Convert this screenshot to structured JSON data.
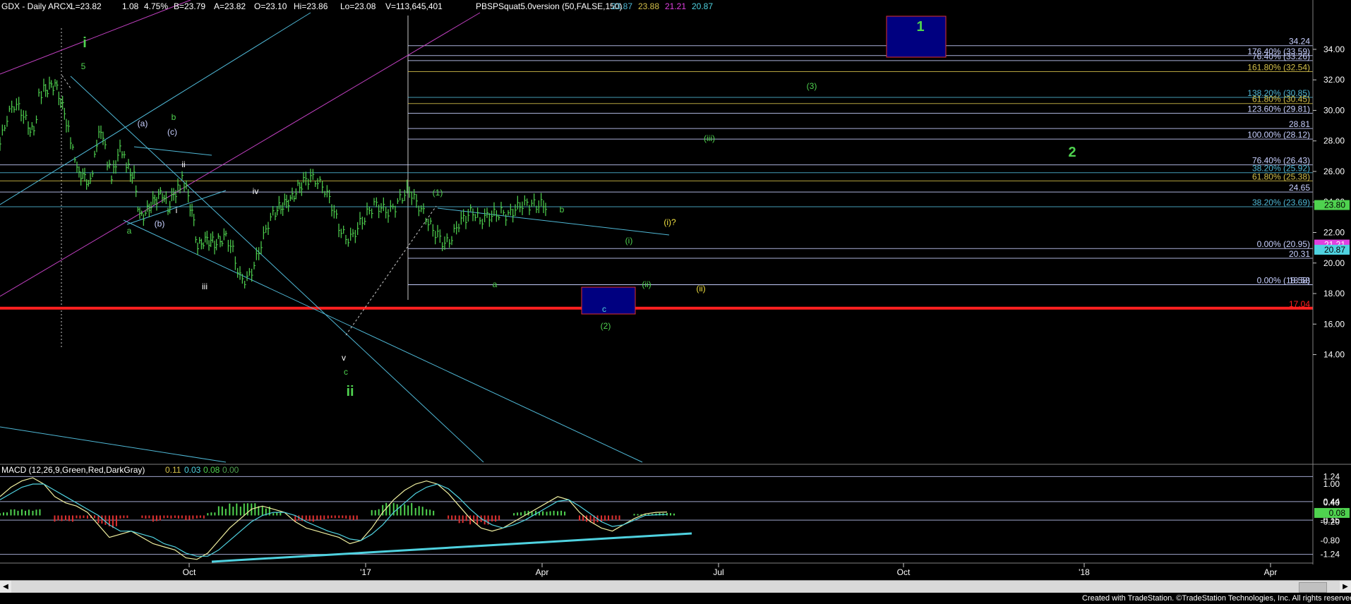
{
  "header": {
    "symbol": "GDX - Daily  ARCX",
    "last": "L=23.82",
    "change": "1.08",
    "change_pct": "4.75%",
    "bid": "B=23.79",
    "ask": "A=23.82",
    "open": "O=23.10",
    "high": "Hi=23.86",
    "low": "Lo=23.08",
    "volume": "V=113,645,401",
    "indicator": "PBSPSquat5.0version (50,FALSE,150)",
    "ind_values": [
      {
        "text": "23.87",
        "color": "#4fb8d6"
      },
      {
        "text": "23.88",
        "color": "#d4c04a"
      },
      {
        "text": "21.21",
        "color": "#e040e0"
      },
      {
        "text": "20.87",
        "color": "#4fd2e0"
      }
    ]
  },
  "macd_header": {
    "label": "MACD (12,26,9,Green,Red,DarkGray)",
    "values": [
      {
        "text": "0.11",
        "color": "#d4c04a"
      },
      {
        "text": "0.03",
        "color": "#4fd2e0"
      },
      {
        "text": "0.08",
        "color": "#4fd24f"
      },
      {
        "text": "0.00",
        "color": "#4fa04f"
      }
    ]
  },
  "chart_data": [
    {
      "type": "line",
      "subtype": "ohlc-bars",
      "title": "GDX - Daily",
      "ylim": [
        12.5,
        36.4
      ],
      "y_ticks": [
        14.0,
        16.0,
        18.0,
        20.0,
        22.0,
        24.0,
        26.0,
        28.0,
        30.0,
        32.0,
        34.0
      ],
      "y_tick_labels": [
        "14.00",
        "16.00",
        "18.00",
        "20.00",
        "22.00",
        "24.00",
        "26.00",
        "28.00",
        "30.00",
        "32.00",
        "34.00"
      ],
      "x_tick_labels": [
        "Oct",
        "'17",
        "Apr",
        "Jul",
        "Oct",
        "'18",
        "Apr"
      ],
      "series": [
        {
          "color": "#4fd24f",
          "x": [
            0,
            10,
            20,
            30,
            40,
            48,
            55,
            62,
            70,
            78,
            86,
            94,
            100,
            106,
            112,
            120,
            128,
            134,
            140,
            146,
            152,
            158,
            164,
            170,
            176,
            182,
            190,
            198,
            206,
            214,
            222,
            230,
            238,
            246,
            252,
            258,
            264,
            272,
            280,
            288,
            296,
            304,
            312,
            320,
            330,
            340,
            350,
            360,
            370,
            380,
            390,
            398,
            406,
            414,
            422,
            430,
            440,
            450,
            460,
            470,
            480,
            490,
            500,
            510,
            520,
            530,
            540,
            550,
            560,
            570,
            580,
            590,
            600,
            610,
            620,
            630,
            640,
            650,
            660,
            670,
            680,
            690,
            700,
            710,
            720,
            730,
            740,
            750,
            760,
            770,
            776
          ],
          "values": [
            27.8,
            29.5,
            30.4,
            30.0,
            29.0,
            28.6,
            30.9,
            31.3,
            31.5,
            31.7,
            30.6,
            29.3,
            28.2,
            27.0,
            26.0,
            25.6,
            25.2,
            26.8,
            28.4,
            28.2,
            26.6,
            25.8,
            26.6,
            27.8,
            27.0,
            26.2,
            25.6,
            23.0,
            23.2,
            23.8,
            24.2,
            24.6,
            23.6,
            24.5,
            24.9,
            25.4,
            24.8,
            23.3,
            21.0,
            21.4,
            21.5,
            21.3,
            21.5,
            21.8,
            20.8,
            19.0,
            18.9,
            19.8,
            21.2,
            22.6,
            23.4,
            23.7,
            24.0,
            24.3,
            24.9,
            25.3,
            25.6,
            25.3,
            24.8,
            23.8,
            22.4,
            21.6,
            21.8,
            22.6,
            23.2,
            23.8,
            23.6,
            23.3,
            23.7,
            24.4,
            24.8,
            24.0,
            23.3,
            22.4,
            21.8,
            21.2,
            21.6,
            22.6,
            23.0,
            23.4,
            22.8,
            23.1,
            23.2,
            23.3,
            23.1,
            23.5,
            23.82,
            23.82,
            23.82,
            23.82,
            23.82
          ]
        }
      ],
      "horizontal_levels": [
        {
          "value": 34.24,
          "label": "34.24",
          "color": "#c8d0ff"
        },
        {
          "value": 33.59,
          "label": "176.40% (33.59)",
          "color": "#c8d0ff"
        },
        {
          "value": 33.26,
          "label": "76.40% (33.26)",
          "color": "#c8d0ff"
        },
        {
          "value": 32.54,
          "label": "161.80% (32.54)",
          "color": "#d4c04a"
        },
        {
          "value": 30.85,
          "label": "138.20% (30.85)",
          "color": "#4fb8d6"
        },
        {
          "value": 30.45,
          "label": "61.80% (30.45)",
          "color": "#d4c04a"
        },
        {
          "value": 29.81,
          "label": "123.60% (29.81)",
          "color": "#c8d0ff"
        },
        {
          "value": 28.81,
          "label": "28.81",
          "color": "#c8d0ff"
        },
        {
          "value": 28.12,
          "label": "100.00% (28.12)",
          "color": "#c8d0ff"
        },
        {
          "value": 26.43,
          "label": "76.40% (26.43)",
          "color": "#c8d0ff"
        },
        {
          "value": 25.92,
          "label": "38.20% (25.92)",
          "color": "#4fb8d6"
        },
        {
          "value": 25.38,
          "label": "61.80% (25.38)",
          "color": "#d4c04a"
        },
        {
          "value": 24.65,
          "label": "24.65",
          "color": "#c8d0ff"
        },
        {
          "value": 23.69,
          "label": "38.20% (23.69)",
          "color": "#4fb8d6"
        },
        {
          "value": 20.95,
          "label": "0.00% (20.95)",
          "color": "#c8d0ff"
        },
        {
          "value": 20.31,
          "label": "20.31",
          "color": "#c8d0ff"
        },
        {
          "value": 18.58,
          "label": "18.58",
          "color": "#c8d0ff"
        },
        {
          "value": 18.58,
          "label": "0.00% (18.58)",
          "color": "#c8d0ff"
        },
        {
          "value": 17.04,
          "label": "17.04",
          "color": "#ff2020"
        }
      ],
      "price_tags": [
        {
          "value": 23.8,
          "label": "23.80",
          "bg": "#4fd24f",
          "fg": "#000000"
        },
        {
          "value": 21.21,
          "label": "21.21",
          "bg": "#e040e0",
          "fg": "#ffffff"
        },
        {
          "value": 20.87,
          "label": "20.87",
          "bg": "#4fd2e0",
          "fg": "#000000"
        }
      ],
      "annotations": [
        {
          "text": "i",
          "color": "#4fd24f",
          "big": true
        },
        {
          "text": "5",
          "color": "#4fd24f"
        },
        {
          "text": "b",
          "color": "#4fd24f"
        },
        {
          "text": "(a)",
          "color": "#c8d0ff"
        },
        {
          "text": "(c)",
          "color": "#c8d0ff"
        },
        {
          "text": "ii",
          "color": "#ffffff"
        },
        {
          "text": "i",
          "color": "#ffffff"
        },
        {
          "text": "a",
          "color": "#4fd24f"
        },
        {
          "text": "(b)",
          "color": "#c8d0ff"
        },
        {
          "text": "iv",
          "color": "#ffffff"
        },
        {
          "text": "iii",
          "color": "#ffffff"
        },
        {
          "text": "v",
          "color": "#ffffff"
        },
        {
          "text": "c",
          "color": "#4fd24f"
        },
        {
          "text": "ii",
          "color": "#4fd24f",
          "big": true
        },
        {
          "text": "(1)",
          "color": "#4fd24f"
        },
        {
          "text": "a",
          "color": "#4fd24f"
        },
        {
          "text": "b",
          "color": "#4fd24f"
        },
        {
          "text": "c",
          "color": "#4fd2e0"
        },
        {
          "text": "(2)",
          "color": "#4fd24f"
        },
        {
          "text": "(i)",
          "color": "#4fd24f"
        },
        {
          "text": "(ii)",
          "color": "#4fd24f"
        },
        {
          "text": "(i)?",
          "color": "#f0e040"
        },
        {
          "text": "(ii)",
          "color": "#f0e040"
        },
        {
          "text": "(iii)",
          "color": "#4fd24f"
        },
        {
          "text": "(3)",
          "color": "#4fd24f"
        },
        {
          "text": "1",
          "color": "#4fd24f",
          "big": true
        },
        {
          "text": "2",
          "color": "#4fd24f",
          "big": true
        }
      ]
    },
    {
      "type": "line",
      "title": "MACD (12,26,9,Green,Red,DarkGray)",
      "ylim": [
        -1.45,
        1.45
      ],
      "y_tick_labels": [
        "1.24",
        "1.00",
        "0.44",
        "0.40",
        "-0.15",
        "-0.20",
        "-0.80",
        "-1.24"
      ],
      "levels": [
        1.24,
        0.44,
        -0.15,
        -1.24
      ],
      "series": [
        {
          "name": "MACD",
          "color": "#f0f0a0",
          "values": [
            0.6,
            0.9,
            1.1,
            1.2,
            1.0,
            0.6,
            0.4,
            0.3,
            0.1,
            -0.3,
            -0.7,
            -0.6,
            -0.5,
            -0.7,
            -0.9,
            -1.0,
            -1.1,
            -1.35,
            -1.4,
            -1.2,
            -0.8,
            -0.4,
            -0.1,
            0.2,
            0.3,
            0.2,
            0.1,
            -0.2,
            -0.4,
            -0.5,
            -0.6,
            -0.7,
            -0.9,
            -0.8,
            -0.4,
            0.1,
            0.5,
            0.8,
            1.0,
            1.1,
            1.0,
            0.7,
            0.3,
            -0.1,
            -0.4,
            -0.5,
            -0.4,
            -0.2,
            0.0,
            0.2,
            0.4,
            0.6,
            0.5,
            0.1,
            -0.2,
            -0.4,
            -0.5,
            -0.3,
            -0.1,
            0.05,
            0.1,
            0.11
          ]
        },
        {
          "name": "Signal",
          "color": "#4fd2e0",
          "values": [
            0.5,
            0.7,
            0.9,
            1.0,
            1.0,
            0.8,
            0.6,
            0.4,
            0.2,
            0.0,
            -0.3,
            -0.5,
            -0.5,
            -0.6,
            -0.7,
            -0.9,
            -1.0,
            -1.2,
            -1.3,
            -1.3,
            -1.1,
            -0.8,
            -0.5,
            -0.2,
            0.0,
            0.1,
            0.1,
            0.0,
            -0.2,
            -0.35,
            -0.5,
            -0.6,
            -0.75,
            -0.8,
            -0.6,
            -0.3,
            0.1,
            0.4,
            0.7,
            0.9,
            1.0,
            0.85,
            0.55,
            0.2,
            -0.1,
            -0.3,
            -0.4,
            -0.3,
            -0.15,
            0.05,
            0.25,
            0.45,
            0.5,
            0.3,
            0.05,
            -0.2,
            -0.35,
            -0.3,
            -0.15,
            0.0,
            0.02,
            0.03
          ]
        }
      ],
      "histogram": [
        0.1,
        0.2,
        0.2,
        0.2,
        0.0,
        -0.2,
        -0.2,
        -0.1,
        -0.1,
        -0.3,
        -0.4,
        -0.1,
        0.0,
        -0.1,
        -0.2,
        -0.1,
        -0.1,
        -0.15,
        -0.1,
        0.1,
        0.3,
        0.4,
        0.4,
        0.4,
        0.3,
        0.1,
        0.0,
        -0.2,
        -0.2,
        -0.15,
        -0.1,
        -0.1,
        -0.15,
        0.0,
        0.2,
        0.4,
        0.4,
        0.4,
        0.3,
        0.2,
        0.0,
        -0.15,
        -0.25,
        -0.3,
        -0.3,
        -0.2,
        0.0,
        0.1,
        0.15,
        0.15,
        0.15,
        0.15,
        0.0,
        -0.2,
        -0.25,
        -0.2,
        -0.15,
        0.0,
        0.05,
        0.05,
        0.08,
        0.08
      ]
    }
  ],
  "footer": {
    "credit": "Created with TradeStation. ©TradeStation Technologies, Inc. All rights reserved."
  },
  "colors": {
    "background": "#000000",
    "price_bars": "#4fd24f",
    "red_line": "#ff2020",
    "channel_cyan": "#4fb8d6",
    "channel_magenta": "#c040c0",
    "target_box": "#000080"
  }
}
